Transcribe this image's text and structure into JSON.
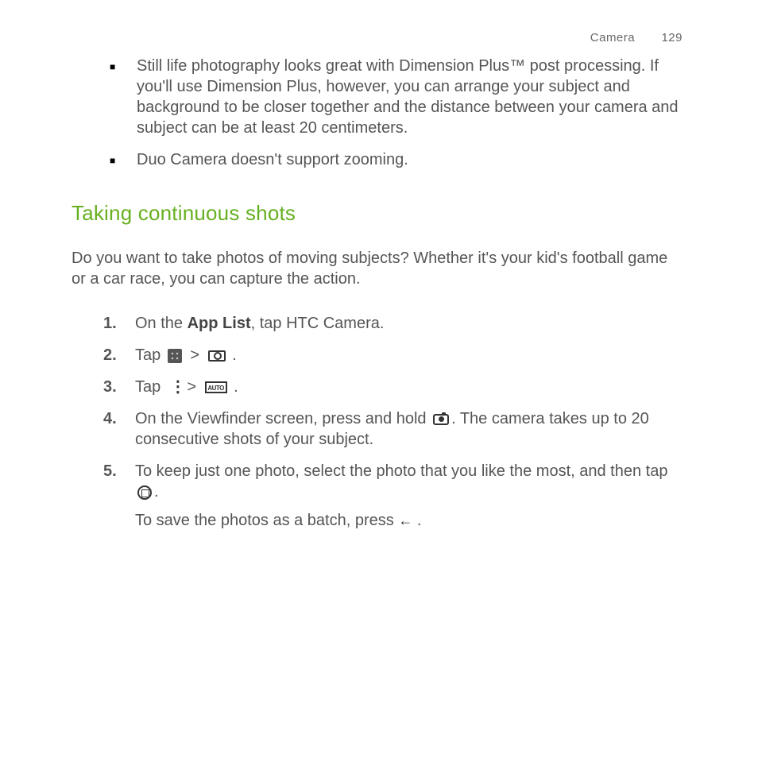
{
  "header": {
    "section": "Camera",
    "page": "129"
  },
  "bullets": [
    "Still life photography looks great with Dimension Plus™ post processing. If you'll use Dimension Plus, however, you can arrange your subject and background to be closer together and the distance between your camera and subject can be at least 20 centimeters.",
    "Duo Camera doesn't support zooming."
  ],
  "heading": "Taking continuous shots",
  "intro": "Do you want to take photos of moving subjects? Whether it's your kid's football game or a car race, you can capture the action.",
  "steps": {
    "s1_a": "On the ",
    "s1_bold": "App List",
    "s1_b": ", tap HTC Camera.",
    "s2": "Tap ",
    "s3": "Tap ",
    "s4_a": "On the Viewfinder screen, press and hold ",
    "s4_b": ". The camera takes up to 20 consecutive shots of your subject.",
    "s5_a": "To keep just one photo, select the photo that you like the most, and then tap ",
    "s5_b": ".",
    "s5_sub_a": "To save the photos as a batch, press ",
    "s5_sub_b": " ."
  },
  "numbers": [
    "1.",
    "2.",
    "3.",
    "4.",
    "5."
  ],
  "icons": {
    "auto_label": "AUTO"
  }
}
